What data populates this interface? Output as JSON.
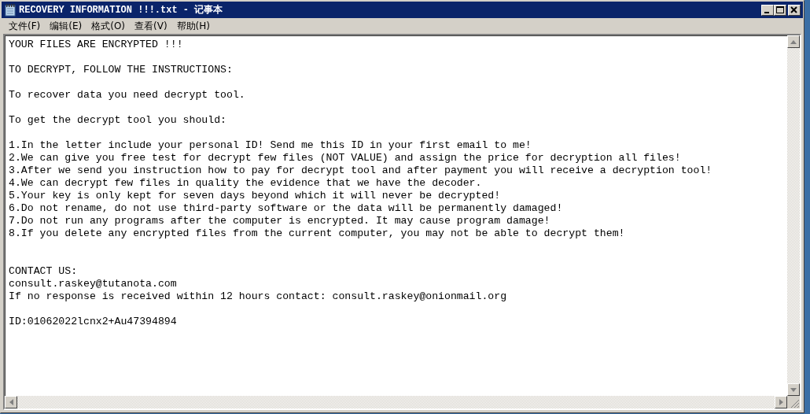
{
  "window": {
    "title": "RECOVERY INFORMATION !!!.txt - 记事本"
  },
  "menu": [
    "文件(F)",
    "编辑(E)",
    "格式(O)",
    "查看(V)",
    "帮助(H)"
  ],
  "document": {
    "paragraphs": [
      [
        "YOUR FILES ARE ENCRYPTED !!!"
      ],
      [
        "TO DECRYPT, FOLLOW THE INSTRUCTIONS:"
      ],
      [
        "To recover data you need decrypt tool."
      ],
      [
        "To get the decrypt tool you should:"
      ],
      [
        "1.In the letter include your personal ID! Send me this ID in your first email to me!",
        "2.We can give you free test for decrypt few files (NOT VALUE) and assign the price for decryption all files!",
        "3.After we send you instruction how to pay for decrypt tool and after payment you will receive a decryption tool!",
        "4.We can decrypt few files in quality the evidence that we have the decoder.",
        "5.Your key is only kept for seven days beyond which it will never be decrypted!",
        "6.Do not rename, do not use third-party software or the data will be permanently damaged!",
        "7.Do not run any programs after the computer is encrypted. It may cause program damage!",
        "8.If you delete any encrypted files from the current computer, you may not be able to decrypt them!"
      ]
    ],
    "contact": [
      "CONTACT US:",
      "consult.raskey@tutanota.com",
      "If no response is received within 12 hours contact: consult.raskey@onionmail.org"
    ],
    "id_line": "ID:01062022lcnx2+Au47394894"
  }
}
